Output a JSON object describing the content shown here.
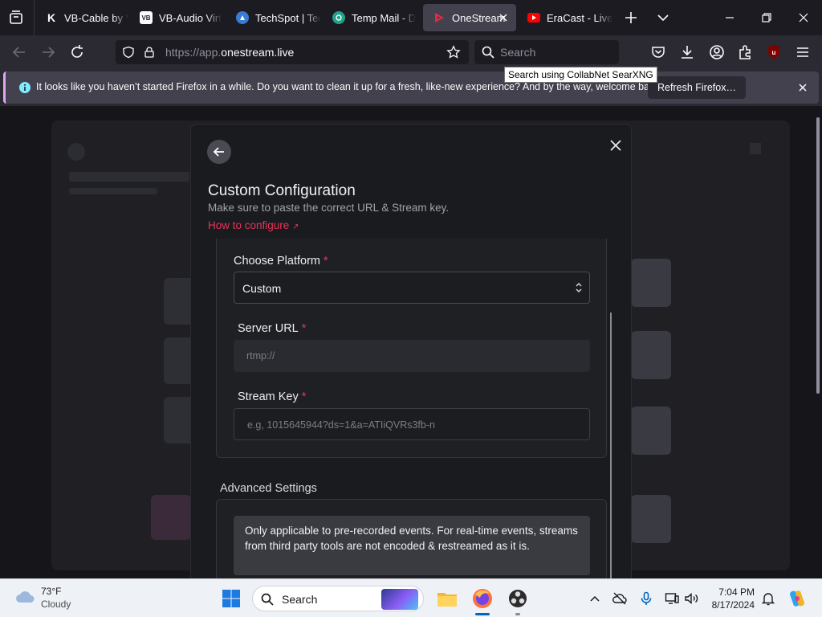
{
  "browser": {
    "tabs": [
      {
        "title": "VB-Cable by V",
        "icon": "k-logo-icon",
        "active": false
      },
      {
        "title": "VB-Audio Virt",
        "icon": "vb-logo-icon",
        "active": false
      },
      {
        "title": "TechSpot | Tec",
        "icon": "techspot-icon",
        "active": false
      },
      {
        "title": "Temp Mail - D",
        "icon": "tempmail-icon",
        "active": false
      },
      {
        "title": "OneStream",
        "icon": "onestream-icon",
        "active": true
      },
      {
        "title": "EraCast - Live",
        "icon": "youtube-icon",
        "active": false
      }
    ],
    "url_prefix": "https://app.",
    "url_domain": "onestream.live",
    "search_placeholder": "Search",
    "search_tooltip": "Search using CollabNet SearXNG",
    "extension_badge": "8"
  },
  "notification": {
    "message": "It looks like you haven’t started Firefox in a while. Do you want to clean it up for a fresh, like-new experience? And by the way, welcome back!",
    "button_label": "Refresh Firefox…"
  },
  "modal": {
    "title": "Custom Configuration",
    "subtitle": "Make sure to paste the correct URL & Stream key.",
    "link_text": "How to configure",
    "platform_label": "Choose Platform",
    "platform_value": "Custom",
    "server_url_label": "Server URL",
    "server_url_placeholder": "rtmp://",
    "stream_key_label": "Stream Key",
    "stream_key_placeholder": "e.g, 1015645944?ds=1&a=ATIiQVRs3fb-n",
    "required_marker": "*",
    "advanced_label": "Advanced Settings",
    "advanced_note": "Only applicable to pre-recorded events. For real-time events, streams from third party tools are not encoded & restreamed as it is."
  },
  "taskbar": {
    "temperature": "73°F",
    "condition": "Cloudy",
    "search_label": "Search",
    "time": "7:04 PM",
    "date": "8/17/2024"
  },
  "colors": {
    "accent_link": "#e6345a",
    "onestream_red": "#e12b45",
    "youtube_red": "#ff0000",
    "notification_accent": "#e1a6f0"
  }
}
